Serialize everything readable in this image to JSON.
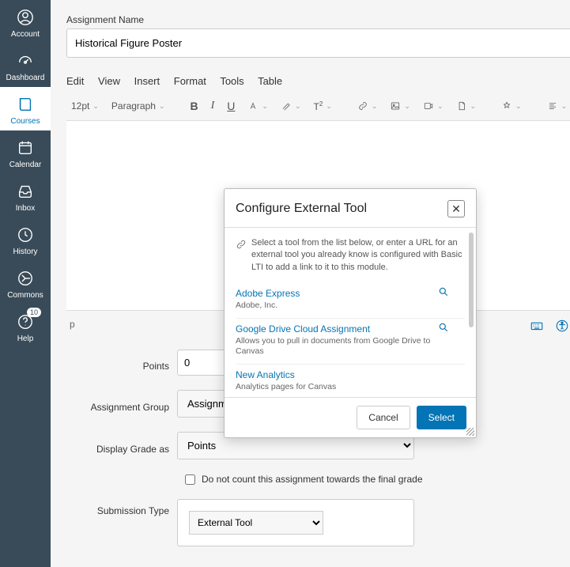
{
  "sidebar": {
    "items": [
      {
        "label": "Account",
        "icon": "user-circle-icon"
      },
      {
        "label": "Dashboard",
        "icon": "gauge-icon"
      },
      {
        "label": "Courses",
        "icon": "book-icon",
        "active": true
      },
      {
        "label": "Calendar",
        "icon": "calendar-icon"
      },
      {
        "label": "Inbox",
        "icon": "inbox-icon"
      },
      {
        "label": "History",
        "icon": "clock-icon"
      },
      {
        "label": "Commons",
        "icon": "share-icon"
      },
      {
        "label": "Help",
        "icon": "help-icon",
        "badge": "10"
      }
    ]
  },
  "assignment": {
    "name_label": "Assignment Name",
    "name_value": "Historical Figure Poster"
  },
  "editor": {
    "menus": [
      "Edit",
      "View",
      "Insert",
      "Format",
      "Tools",
      "Table"
    ],
    "font_size": "12pt",
    "block_format": "Paragraph",
    "path": "p"
  },
  "form": {
    "points": {
      "label": "Points",
      "value": "0"
    },
    "group": {
      "label": "Assignment Group",
      "value": "Assignments"
    },
    "display": {
      "label": "Display Grade as",
      "value": "Points"
    },
    "exclude": {
      "label": "Do not count this assignment towards the final grade",
      "checked": false
    },
    "submission": {
      "label": "Submission Type",
      "value": "External Tool"
    }
  },
  "modal": {
    "title": "Configure External Tool",
    "intro": "Select a tool from the list below, or enter a URL for an external tool you already know is configured with Basic LTI to add a link to it to this module.",
    "tools": [
      {
        "name": "Adobe Express",
        "sub": "Adobe, Inc.",
        "search": true
      },
      {
        "name": "Google Drive Cloud Assignment",
        "sub": "Allows you to pull in documents from Google Drive to Canvas",
        "search": true
      },
      {
        "name": "New Analytics",
        "sub": "Analytics pages for Canvas",
        "search": false
      }
    ],
    "cancel": "Cancel",
    "select": "Select"
  }
}
